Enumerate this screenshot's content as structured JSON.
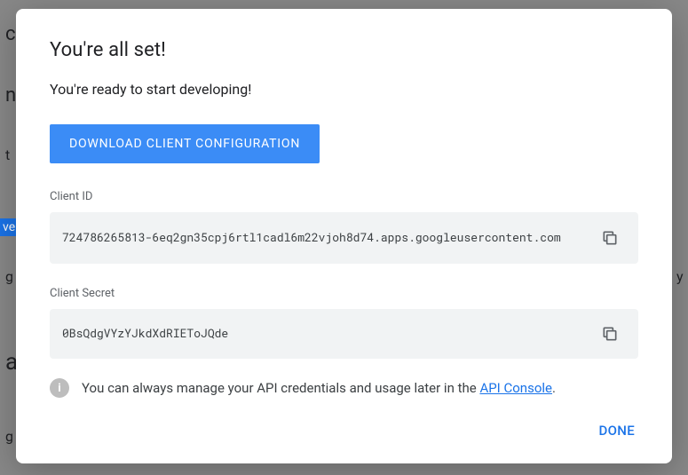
{
  "modal": {
    "title": "You're all set!",
    "subtitle": "You're ready to start developing!",
    "download_button": "DOWNLOAD CLIENT CONFIGURATION",
    "client_id_label": "Client ID",
    "client_id_value": "724786265813-6eq2gn35cpj6rtl1cadl6m22vjoh8d74.apps.googleusercontent.com",
    "client_secret_label": "Client Secret",
    "client_secret_value": "0BsQdgVYzYJkdXdRIEToJQde",
    "info_text_prefix": "You can always manage your API credentials and usage later in the ",
    "info_link_text": "API Console",
    "info_text_suffix": ".",
    "done_button": "DONE"
  },
  "icons": {
    "copy": "copy-icon",
    "info_glyph": "i"
  },
  "background": {
    "words": [
      "c",
      "n",
      "t",
      "ve",
      "g",
      "a",
      "g"
    ],
    "right_char": "y"
  }
}
